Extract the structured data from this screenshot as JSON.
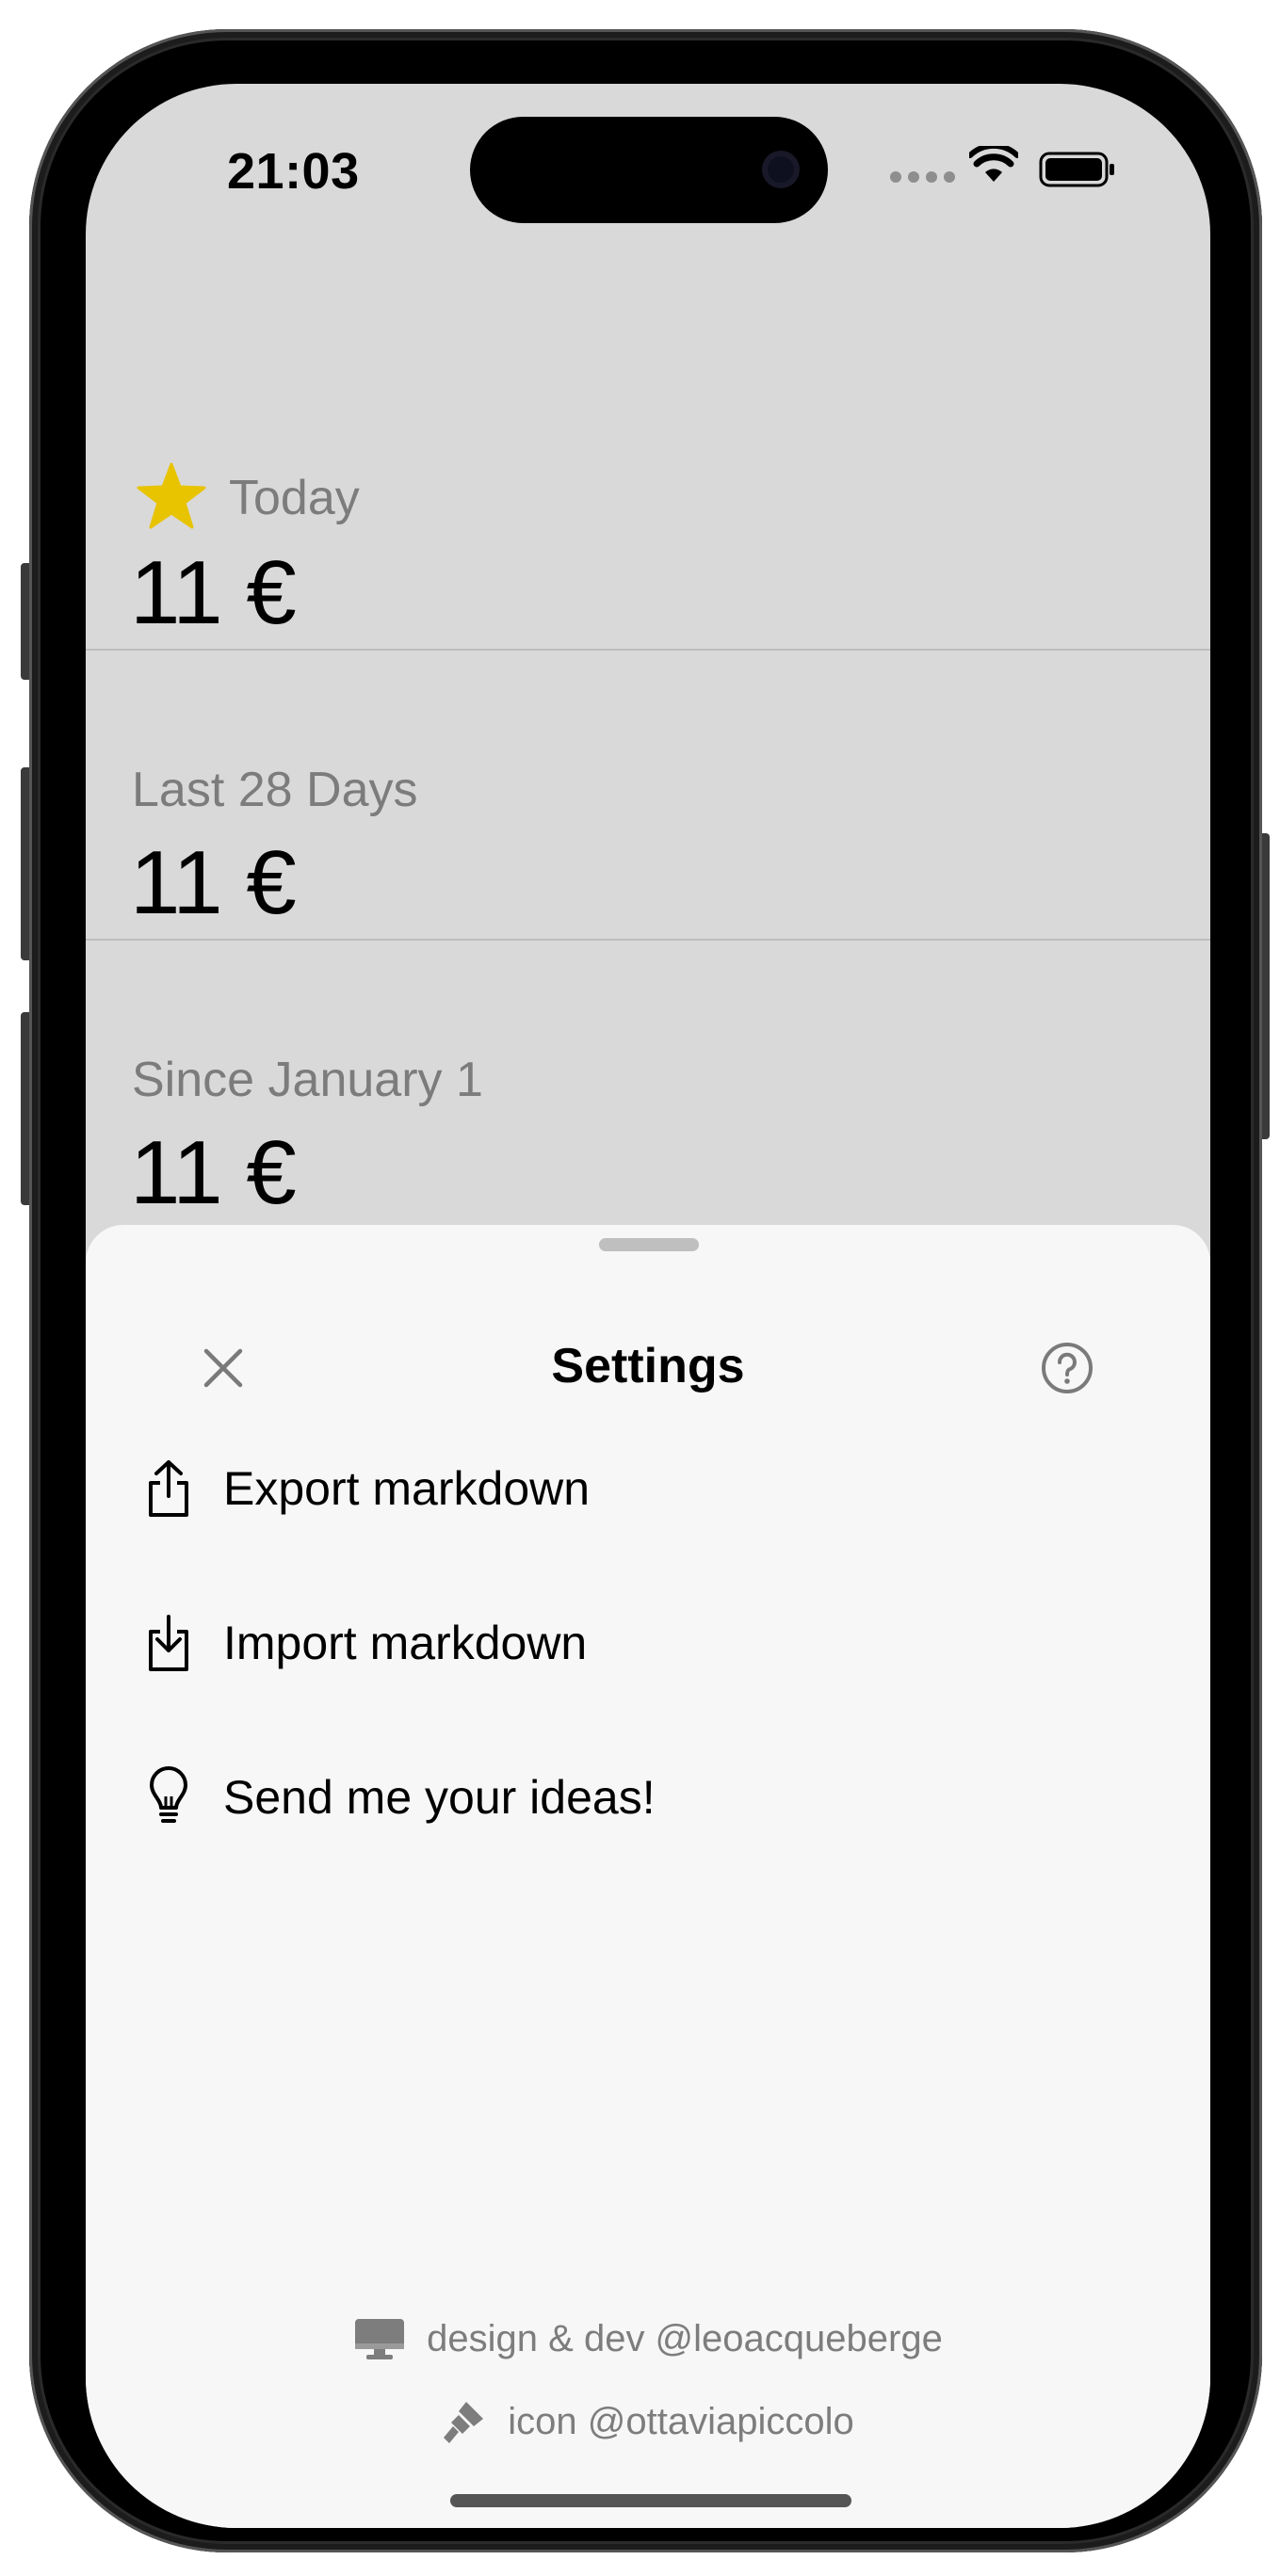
{
  "status_bar": {
    "time": "21:03",
    "signal_icon": "signal-dots-icon",
    "wifi_icon": "wifi-icon",
    "battery_icon": "battery-icon"
  },
  "stats": [
    {
      "label": "Today",
      "amount": "11 €",
      "icon": "star-icon",
      "icon_color": "#e8c300"
    },
    {
      "label": "Last 28 Days",
      "amount": "11 €"
    },
    {
      "label": "Since January 1",
      "amount": "11 €"
    }
  ],
  "settings_sheet": {
    "title": "Settings",
    "close_icon": "close-icon",
    "help_icon": "question-mark-circle-icon",
    "items": [
      {
        "label": "Export markdown",
        "icon": "share-upload-icon"
      },
      {
        "label": "Import markdown",
        "icon": "download-tray-icon"
      },
      {
        "label": "Send me your ideas!",
        "icon": "lightbulb-icon"
      }
    ],
    "credits": [
      {
        "text": "design & dev @leoacqueberge",
        "icon": "desktop-computer-icon"
      },
      {
        "text": "icon @ottaviapiccolo",
        "icon": "paintbrush-icon"
      }
    ]
  },
  "colors": {
    "background_dimmed": "#d9d9d9",
    "sheet_background": "#f7f7f7",
    "star": "#e8c300",
    "secondary_text": "#7c7c7c"
  }
}
